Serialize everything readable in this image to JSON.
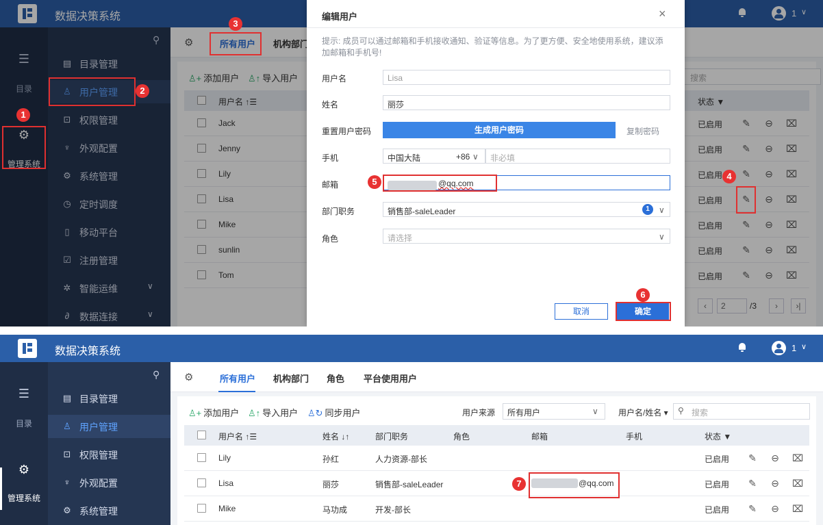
{
  "app": {
    "title": "数据决策系统",
    "user_badge": "1"
  },
  "rail": {
    "catalog_label": "目录",
    "admin_label": "管理系统"
  },
  "nav": {
    "items": [
      {
        "label": "目录管理"
      },
      {
        "label": "用户管理"
      },
      {
        "label": "权限管理"
      },
      {
        "label": "外观配置"
      },
      {
        "label": "系统管理"
      },
      {
        "label": "定时调度"
      },
      {
        "label": "移动平台"
      },
      {
        "label": "注册管理"
      },
      {
        "label": "智能运维"
      },
      {
        "label": "数据连接"
      }
    ]
  },
  "tabs": {
    "all_users": "所有用户",
    "departments": "机构部门",
    "roles": "角色",
    "platform_users": "平台使用用户"
  },
  "toolbar": {
    "add_user": "添加用户",
    "import_user": "导入用户",
    "sync_user": "同步用户",
    "source_label": "用户来源",
    "source_value": "所有用户",
    "filter_label": "用户名/姓名",
    "search_placeholder": "搜索"
  },
  "table": {
    "headers": {
      "username": "用户名",
      "realname": "姓名",
      "dept": "部门职务",
      "role": "角色",
      "email": "邮箱",
      "phone": "手机",
      "status": "状态"
    },
    "rows_top": [
      {
        "username": "Jack",
        "status": "已启用"
      },
      {
        "username": "Jenny",
        "status": "已启用"
      },
      {
        "username": "Lily",
        "status": "已启用"
      },
      {
        "username": "Lisa",
        "status": "已启用"
      },
      {
        "username": "Mike",
        "status": "已启用"
      },
      {
        "username": "sunlin",
        "status": "已启用"
      },
      {
        "username": "Tom",
        "status": "已启用"
      }
    ],
    "rows_bottom": [
      {
        "username": "Lily",
        "realname": "孙红",
        "dept": "人力资源-部长",
        "email": "",
        "status": "已启用"
      },
      {
        "username": "Lisa",
        "realname": "丽莎",
        "dept": "销售部-saleLeader",
        "email": "@qq.com",
        "status": "已启用"
      },
      {
        "username": "Mike",
        "realname": "马功成",
        "dept": "开发-部长",
        "email": "",
        "status": "已启用"
      }
    ]
  },
  "pager": {
    "page": "2",
    "total": "/3"
  },
  "modal": {
    "title": "编辑用户",
    "tip": "提示:  成员可以通过邮箱和手机接收通知、验证等信息。为了更方便、安全地使用系统，建议添加邮箱和手机号!",
    "username_label": "用户名",
    "username_value": "Lisa",
    "realname_label": "姓名",
    "realname_value": "丽莎",
    "reset_pwd_label": "重置用户密码",
    "gen_pwd_button": "生成用户密码",
    "copy_pwd_link": "复制密码",
    "phone_label": "手机",
    "phone_region": "中国大陆",
    "phone_code": "+86",
    "phone_placeholder": "非必填",
    "email_label": "邮箱",
    "email_value": "@qq.com",
    "dept_label": "部门职务",
    "dept_value": "销售部-saleLeader",
    "dept_count": "1",
    "role_label": "角色",
    "role_placeholder": "请选择",
    "cancel_button": "取消",
    "ok_button": "确定"
  },
  "markers": [
    "1",
    "2",
    "3",
    "4",
    "5",
    "6",
    "7"
  ],
  "colors": {
    "topbar": "#2b5fa8",
    "accent": "#2b6fd8",
    "highlight": "#e03030",
    "rail": "#1f2d45",
    "nav": "#253652"
  }
}
